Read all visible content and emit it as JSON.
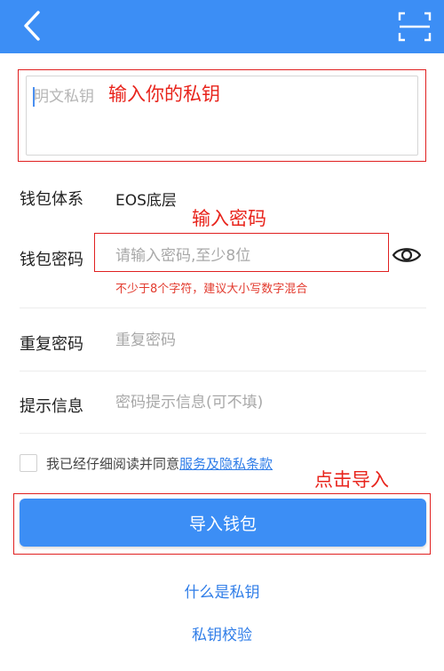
{
  "header": {
    "back_icon": "chevron-left-icon",
    "scan_icon": "scan-frame-icon",
    "bg_color": "#3c8ef5"
  },
  "private_key": {
    "placeholder": "明文私钥",
    "value": ""
  },
  "annotations": {
    "enter_key": "输入你的私钥",
    "enter_password": "输入密码",
    "click_import": "点击导入",
    "color": "#e8241c"
  },
  "wallet_system": {
    "label": "钱包体系",
    "value": "EOS底层"
  },
  "wallet_password": {
    "label": "钱包密码",
    "placeholder": "请输入密码,至少8位",
    "value": "",
    "hint": "不少于8个字符，建议大小写数字混合",
    "toggle_icon": "eye-icon"
  },
  "repeat_password": {
    "label": "重复密码",
    "placeholder": "重复密码",
    "value": ""
  },
  "hint_info": {
    "label": "提示信息",
    "placeholder": "密码提示信息(可不填)",
    "value": ""
  },
  "agreement": {
    "text": "我已经仔细阅读并同意",
    "link": "服务及隐私条款",
    "checked": false
  },
  "import_button": {
    "label": "导入钱包"
  },
  "links": {
    "what_is_private_key": "什么是私钥",
    "verify_private_key": "私钥校验"
  }
}
